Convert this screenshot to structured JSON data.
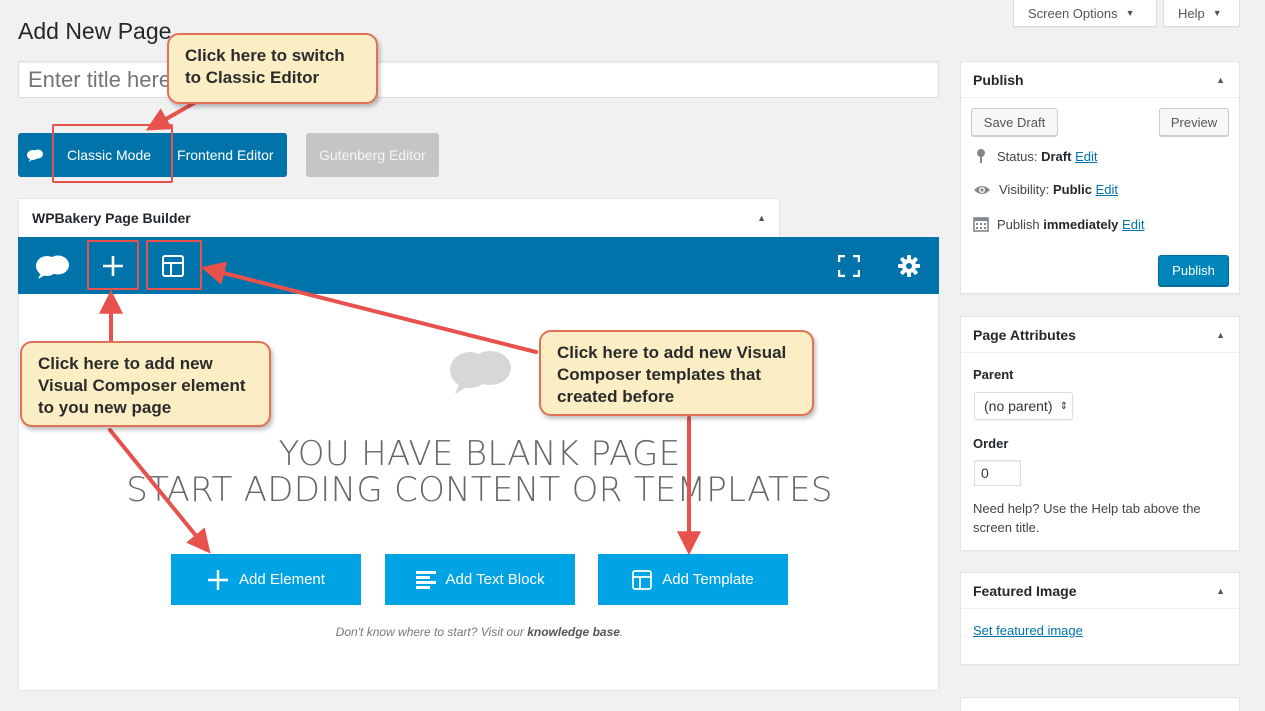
{
  "header": {
    "title": "Add New Page",
    "screen_options_label": "Screen Options",
    "help_label": "Help"
  },
  "title_field": {
    "placeholder": "Enter title here"
  },
  "mode_buttons": {
    "classic": "Classic Mode",
    "frontend": "Frontend Editor",
    "gutenberg": "Gutenberg Editor"
  },
  "wpbakery": {
    "panel_title": "WPBakery Page Builder",
    "blank_line_1": "YOU HAVE BLANK PAGE",
    "blank_line_2": "START ADDING CONTENT OR TEMPLATES",
    "add_element_label": "Add Element",
    "add_text_block_label": "Add Text Block",
    "add_template_label": "Add Template",
    "kb_prefix": "Don't know where to start? Visit our ",
    "kb_link": "knowledge base",
    "kb_suffix": "."
  },
  "publish_box": {
    "title": "Publish",
    "save_draft": "Save Draft",
    "preview": "Preview",
    "status_label": "Status:",
    "status_value": "Draft",
    "visibility_label": "Visibility:",
    "visibility_value": "Public",
    "publish_label": "Publish",
    "publish_when": "immediately",
    "edit_link": "Edit",
    "publish_button": "Publish"
  },
  "page_attributes": {
    "title": "Page Attributes",
    "parent_label": "Parent",
    "parent_value": "(no parent)",
    "order_label": "Order",
    "order_value": "0",
    "help_text": "Need help? Use the Help tab above the screen title."
  },
  "featured_image": {
    "title": "Featured Image",
    "set_link": "Set featured image"
  },
  "callouts": {
    "classic": "Click here to switch to Classic Editor",
    "element": "Click here to add new Visual Composer element to you new page",
    "templates": "Click here to add new Visual Composer templates that created before"
  },
  "colors": {
    "wp_blue": "#0073aa",
    "wpb_button": "#00a4e4",
    "callout_fill": "#fbeec5",
    "callout_border": "#e27056",
    "arrow_red": "#e8524d"
  }
}
